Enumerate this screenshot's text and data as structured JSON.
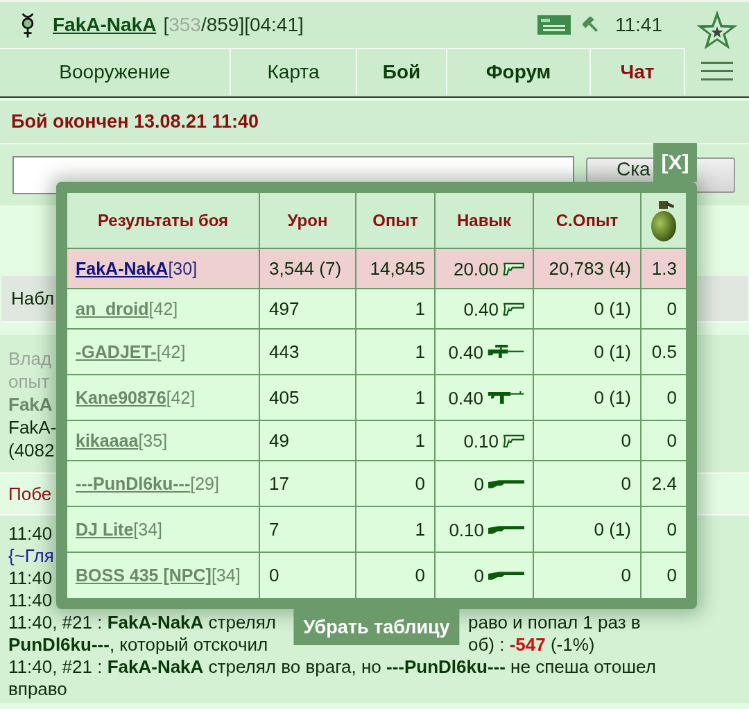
{
  "header": {
    "user_name": "FakA-NakA",
    "stats": [
      {
        "text": "[",
        "kind": "plain"
      },
      {
        "text": "353",
        "kind": "muted"
      },
      {
        "text": "/859][04:41]",
        "kind": "plain"
      }
    ],
    "time": "11:41"
  },
  "nav_tabs": [
    {
      "label": "Вооружение",
      "kind": "plain"
    },
    {
      "label": "Карта",
      "kind": "plain"
    },
    {
      "label": "Бой",
      "kind": "bold"
    },
    {
      "label": "Форум",
      "kind": "bold"
    },
    {
      "label": "Чат",
      "kind": "alert"
    }
  ],
  "battle": {
    "title": "Бой окончен 13.08.21 11:40",
    "say_button": "Ска"
  },
  "watch_label": "Набл",
  "owner_lines": [
    {
      "text": "Влад",
      "kind": "muted"
    },
    {
      "text": "опыт",
      "kind": "muted"
    },
    {
      "text": "FakA",
      "kind": "muted_name"
    },
    {
      "text": "FakA-",
      "kind": "plain"
    },
    {
      "text": "(4082",
      "kind": "plain"
    }
  ],
  "result_label": "Побе",
  "log": [
    {
      "left": [
        {
          "text": "11:40",
          "kind": "plain"
        }
      ]
    },
    {
      "left": [
        {
          "text": "{~Гля",
          "kind": "link"
        }
      ]
    },
    {
      "left": [
        {
          "text": "11:40",
          "kind": "plain"
        }
      ]
    },
    {
      "left": [
        {
          "text": "11:40",
          "kind": "plain"
        }
      ]
    },
    {
      "left": [
        {
          "text": "11:40, #21 : ",
          "kind": "plain"
        },
        {
          "text": "FakA-NakA",
          "kind": "name"
        },
        {
          "text": " стрелял",
          "kind": "plain"
        }
      ],
      "right": [
        {
          "text": "раво и попал 1 раз в",
          "kind": "plain"
        }
      ]
    },
    {
      "left": [
        {
          "text": "PunDl6ku---",
          "kind": "name"
        },
        {
          "text": ", который отскочил",
          "kind": "plain"
        }
      ],
      "right": [
        {
          "text": "об) : ",
          "kind": "plain"
        },
        {
          "text": "-547",
          "kind": "loss"
        },
        {
          "text": " (-1%)",
          "kind": "plain"
        }
      ]
    },
    {
      "left": [
        {
          "text": "11:40, #21 : ",
          "kind": "plain"
        },
        {
          "text": "FakA-NakA",
          "kind": "name"
        },
        {
          "text": " стрелял во врага, но ",
          "kind": "plain"
        },
        {
          "text": "---PunDl6ku---",
          "kind": "name"
        },
        {
          "text": " не спеша отошел",
          "kind": "plain"
        }
      ]
    },
    {
      "left": [
        {
          "text": "вправо",
          "kind": "plain"
        }
      ]
    }
  ],
  "results": {
    "close_button": "[X]",
    "columns": [
      {
        "label": "Результаты боя",
        "kind": "text"
      },
      {
        "label": "Урон",
        "kind": "text"
      },
      {
        "label": "Опыт",
        "kind": "text"
      },
      {
        "label": "Навык",
        "kind": "text"
      },
      {
        "label": "С.Опыт",
        "kind": "text"
      },
      {
        "kind": "grenade"
      }
    ],
    "rows": [
      {
        "name": "FakA-NakA",
        "rank": "[30]",
        "highlighted": true,
        "damage": "3,544 (7)",
        "experience": "14,845",
        "skill": {
          "value": "20.00",
          "kind": "pistol"
        },
        "team_experience": "20,783 (4)",
        "grenade": "1.3"
      },
      {
        "name": "an_droid",
        "rank": "[42]",
        "highlighted": false,
        "damage": "497",
        "experience": "1",
        "skill": {
          "value": "0.40",
          "kind": "pistol"
        },
        "team_experience": "0 (1)",
        "grenade": "0"
      },
      {
        "name": "-GADJET-",
        "rank": "[42]",
        "highlighted": false,
        "damage": "443",
        "experience": "1",
        "skill": {
          "value": "0.40",
          "kind": "sniper"
        },
        "team_experience": "0 (1)",
        "grenade": "0.5"
      },
      {
        "name": "Kane90876",
        "rank": "[42]",
        "highlighted": false,
        "damage": "405",
        "experience": "1",
        "skill": {
          "value": "0.40",
          "kind": "smg"
        },
        "team_experience": "0 (1)",
        "grenade": "0"
      },
      {
        "name": "kikaaaa",
        "rank": "[35]",
        "highlighted": false,
        "damage": "49",
        "experience": "1",
        "skill": {
          "value": "0.10",
          "kind": "pistol"
        },
        "team_experience": "0",
        "grenade": "0"
      },
      {
        "name": "---PunDl6ku---",
        "rank": "[29]",
        "highlighted": false,
        "damage": "17",
        "experience": "0",
        "skill": {
          "value": "0",
          "kind": "shotgun"
        },
        "team_experience": "0",
        "grenade": "2.4"
      },
      {
        "name": "DJ Lite",
        "rank": "[34]",
        "highlighted": false,
        "damage": "7",
        "experience": "1",
        "skill": {
          "value": "0.10",
          "kind": "shotgun"
        },
        "team_experience": "0 (1)",
        "grenade": "0"
      },
      {
        "name": "BOSS 435 [NPC]",
        "rank": "[34]",
        "highlighted": false,
        "damage": "0",
        "experience": "0",
        "skill": {
          "value": "0",
          "kind": "shotgun"
        },
        "team_experience": "0",
        "grenade": "0"
      }
    ],
    "hide_button": "Убрать таблицу"
  }
}
